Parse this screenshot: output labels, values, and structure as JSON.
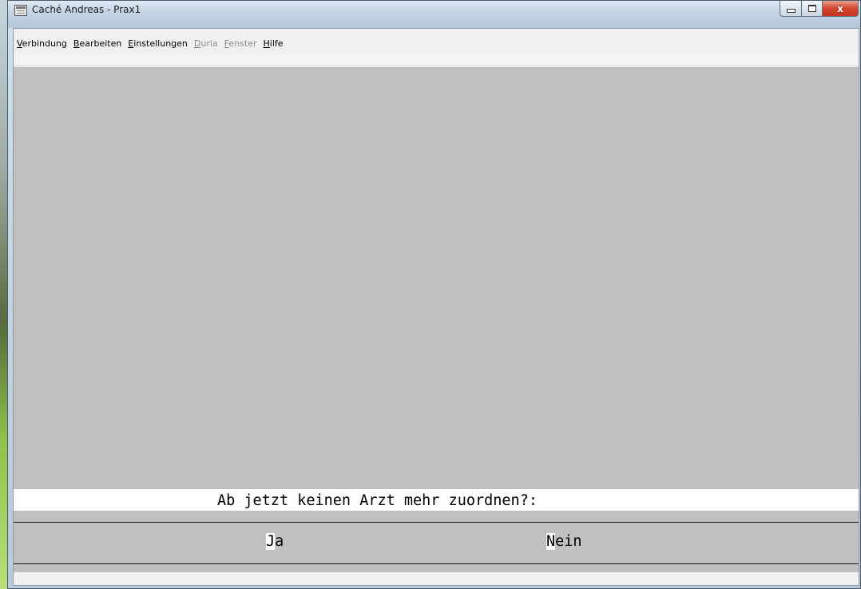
{
  "window": {
    "title": "Caché Andreas - Prax1",
    "close_glyph": "x"
  },
  "menu": [
    {
      "label_hot": "V",
      "label_rest": "erbindung",
      "enabled": true
    },
    {
      "label_hot": "B",
      "label_rest": "earbeiten",
      "enabled": true
    },
    {
      "label_hot": "E",
      "label_rest": "instellungen",
      "enabled": true
    },
    {
      "label_hot": "D",
      "label_rest": "uria",
      "enabled": false
    },
    {
      "label_hot": "F",
      "label_rest": "enster",
      "enabled": false
    },
    {
      "label_hot": "H",
      "label_rest": "ilfe",
      "enabled": true
    }
  ],
  "terminal": {
    "prompt": "Ab jetzt keinen Arzt mehr zuordnen?:",
    "options": {
      "yes_hot": "J",
      "yes_rest": "a",
      "no_hot": "N",
      "no_rest": "ein"
    }
  },
  "colors": {
    "terminal_bg": "#c0c0c0",
    "prompt_bg": "#ffffff",
    "close_button": "#c9361e"
  },
  "icons": [
    "terminal-app-icon",
    "minimize-icon",
    "maximize-icon",
    "close-icon"
  ]
}
